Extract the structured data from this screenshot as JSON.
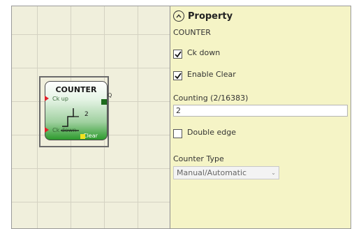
{
  "block": {
    "title": "COUNTER",
    "pin_ck_up": "Ck up",
    "pin_ck_down": "Ck down",
    "pin_clear": "Clear",
    "output_q": "Q",
    "value": "2"
  },
  "properties": {
    "header": "Property",
    "component_name": "COUNTER",
    "ck_down_label": "Ck down",
    "ck_down_checked": true,
    "enable_clear_label": "Enable Clear",
    "enable_clear_checked": true,
    "counting_label": "Counting (2/16383)",
    "counting_value": "2",
    "double_edge_label": "Double edge",
    "double_edge_checked": false,
    "counter_type_label": "Counter Type",
    "counter_type_value": "Manual/Automatic"
  },
  "colors": {
    "canvas_bg": "#f0efdc",
    "panel_bg": "#f5f4c6",
    "input_pin": "#e0202a",
    "output_pin": "#1d6b1d",
    "clear_pin": "#f0e020"
  }
}
